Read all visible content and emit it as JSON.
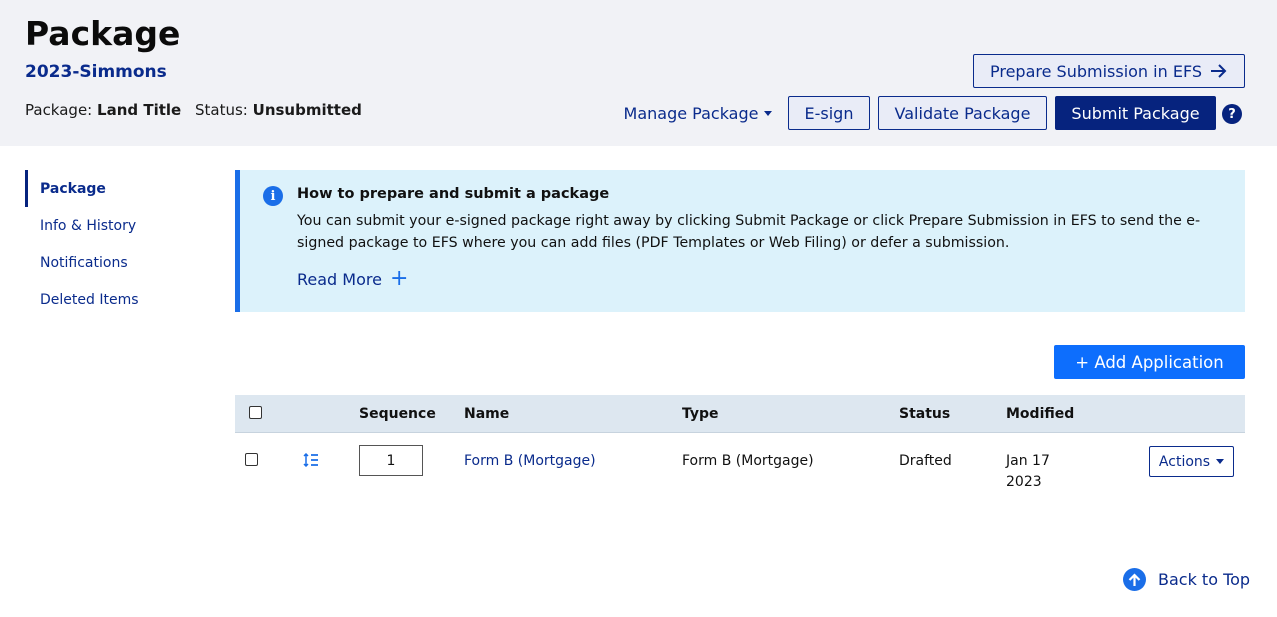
{
  "header": {
    "title": "Package",
    "package_name": "2023-Simmons",
    "package_type_label": "Package:",
    "package_type_value": "Land Title",
    "status_label": "Status:",
    "status_value": "Unsubmitted",
    "prepare_submission_label": "Prepare Submission in EFS",
    "manage_package_label": "Manage Package",
    "esign_label": "E-sign",
    "validate_label": "Validate Package",
    "submit_label": "Submit Package",
    "help_glyph": "?"
  },
  "sidenav": {
    "items": [
      {
        "label": "Package",
        "active": true
      },
      {
        "label": "Info & History",
        "active": false
      },
      {
        "label": "Notifications",
        "active": false
      },
      {
        "label": "Deleted Items",
        "active": false
      }
    ]
  },
  "info": {
    "icon": "info-icon",
    "title": "How to prepare and submit a package",
    "text": "You can submit your e-signed package right away by clicking Submit Package or click Prepare Submission in EFS to send the e-signed package to EFS where you can add files (PDF Templates or Web Filing) or defer a submission.",
    "read_more_label": "Read More"
  },
  "add_application_label": "+ Add Application",
  "table": {
    "columns": [
      "Sequence",
      "Name",
      "Type",
      "Status",
      "Modified"
    ],
    "rows": [
      {
        "sequence": "1",
        "name": "Form B (Mortgage)",
        "type": "Form B (Mortgage)",
        "status": "Drafted",
        "modified_line1": "Jan 17",
        "modified_line2": "2023",
        "actions_label": "Actions"
      }
    ]
  },
  "back_to_top_label": "Back to Top",
  "colors": {
    "brand_navy": "#06237e",
    "link_blue": "#0a2b8c",
    "accent_blue": "#1a6ee8",
    "header_bg": "#f1f2f6",
    "info_bg": "#dcf2fb"
  }
}
